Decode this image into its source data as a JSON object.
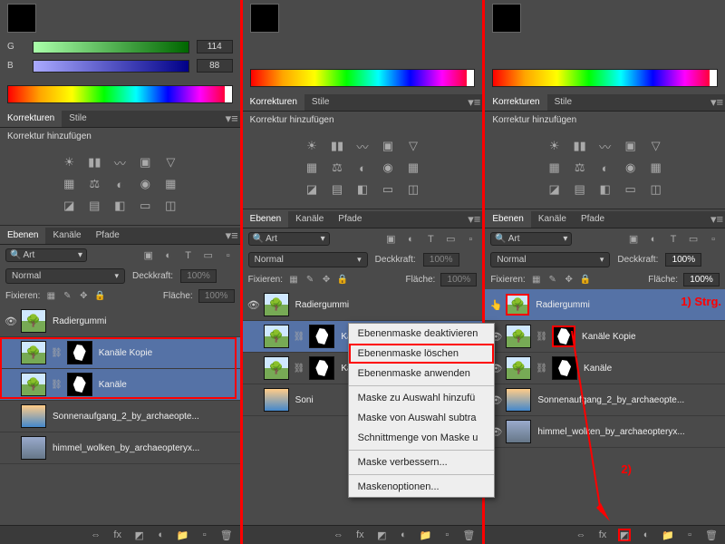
{
  "sliders": {
    "g_label": "G",
    "g_val": "114",
    "b_label": "B",
    "b_val": "88"
  },
  "tabs": {
    "korrekturen": "Korrekturen",
    "stile": "Stile"
  },
  "korr_title": "Korrektur hinzufügen",
  "layers_tabs": {
    "ebenen": "Ebenen",
    "kanale": "Kanäle",
    "pfade": "Pfade"
  },
  "search_label": "Art",
  "blend": "Normal",
  "opacity_label": "Deckkraft:",
  "opacity_val": "100%",
  "lock_label": "Fixieren:",
  "fill_label": "Fläche:",
  "fill_val": "100%",
  "layers": {
    "radier": "Radiergummi",
    "kopie": "Kanäle Kopie",
    "kanale": "Kanäle",
    "sonnen": "Sonnenaufgang_2_by_archaeopte...",
    "sonnen_short": "Soni",
    "himmel": "himmel_wolken_by_archaeopteryx..."
  },
  "ctx": {
    "deakt": "Ebenenmaske deaktivieren",
    "loeschen": "Ebenenmaske löschen",
    "anwenden": "Ebenenmaske anwenden",
    "hinzu": "Maske zu Auswahl hinzufü",
    "subtr": "Maske von Auswahl subtra",
    "schnitt": "Schnittmenge von Maske u",
    "verbessern": "Maske verbessern...",
    "optionen": "Maskenoptionen..."
  },
  "annot": {
    "strg": "1) Strg.",
    "two": "2)"
  },
  "footer": {
    "fx": "fx"
  }
}
